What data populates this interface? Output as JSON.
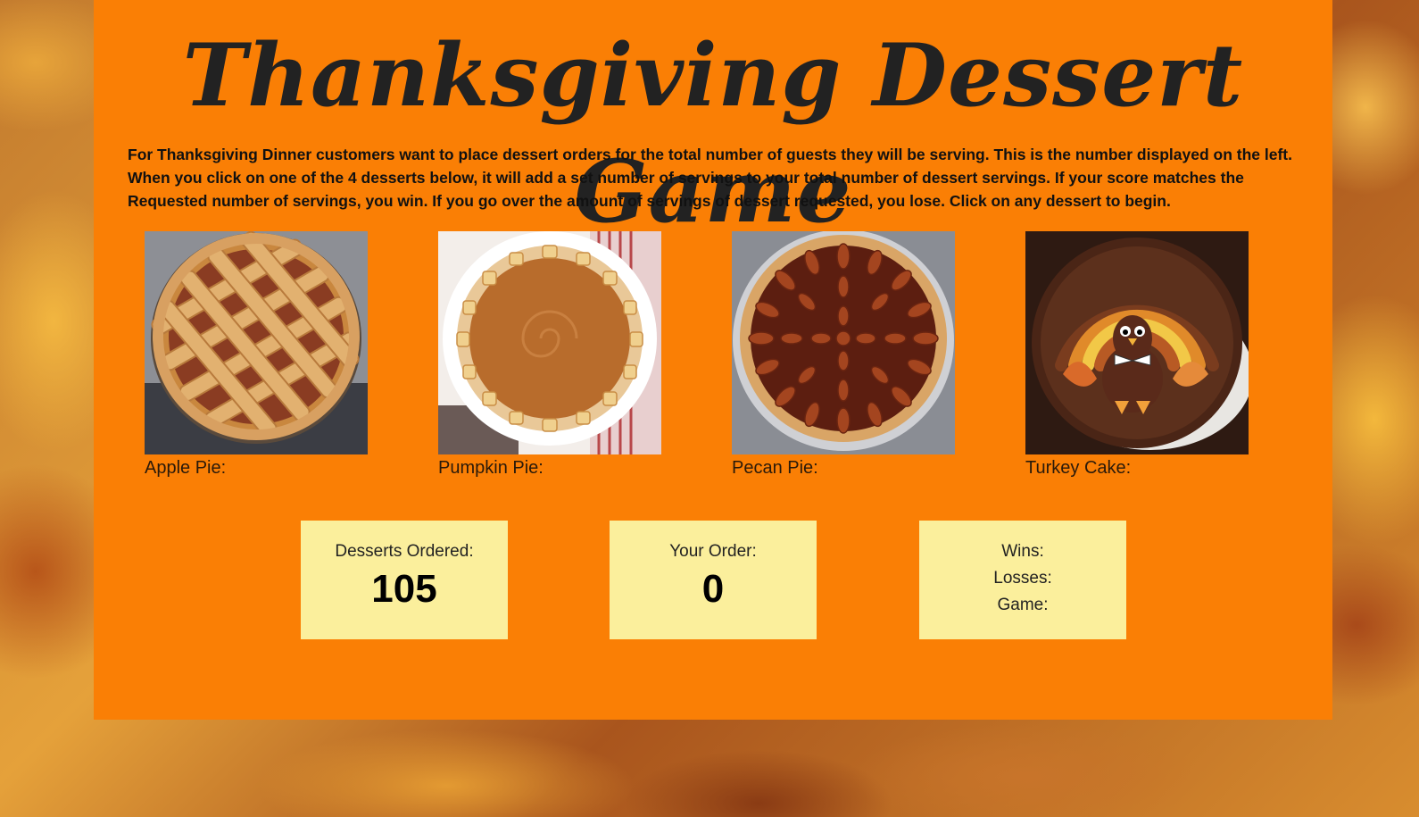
{
  "page": {
    "title": "Thanksgiving Dessert Game",
    "instructions": "For Thanksgiving Dinner customers want to place dessert orders for the total number of guests they will be serving. This is the number displayed on the left. When you click on one of the 4 desserts below, it will add a set number of servings to your total number of dessert servings. If your score matches the Requested number of servings, you win. If you go over the amount of servings of dessert requested, you lose. Click on any dessert to begin."
  },
  "desserts": [
    {
      "label": "Apple Pie:",
      "icon": "apple-pie-image"
    },
    {
      "label": "Pumpkin Pie:",
      "icon": "pumpkin-pie-image"
    },
    {
      "label": "Pecan Pie:",
      "icon": "pecan-pie-image"
    },
    {
      "label": "Turkey Cake:",
      "icon": "turkey-cake-image"
    }
  ],
  "scoreboard": {
    "ordered_label": "Desserts Ordered:",
    "ordered_value": "105",
    "your_order_label": "Your Order:",
    "your_order_value": "0",
    "wins_label": "Wins:",
    "losses_label": "Losses:",
    "game_label": "Game:"
  },
  "colors": {
    "panel": "#fa7f05",
    "score_box": "#fbef9c",
    "title_text": "#222222"
  }
}
